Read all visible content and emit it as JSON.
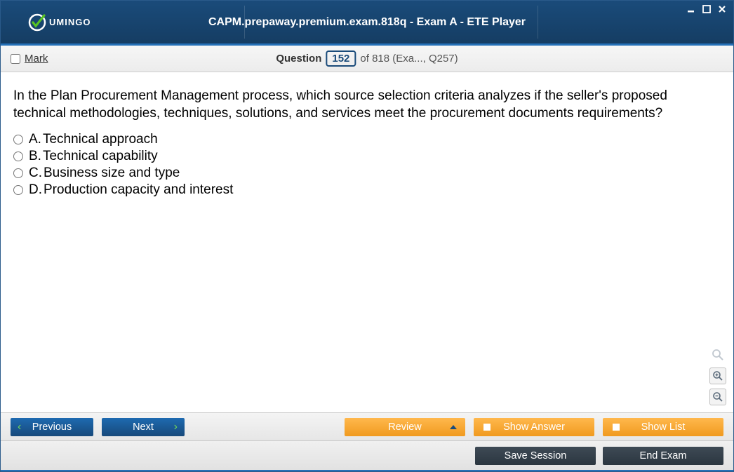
{
  "logo_text": "UMINGO",
  "title": "CAPM.prepaway.premium.exam.818q - Exam A - ETE Player",
  "mark_label": "Mark",
  "question_label": "Question",
  "question_number": "152",
  "question_total": "of 818 (Exa..., Q257)",
  "question_text": "In the Plan Procurement Management process, which source selection criteria analyzes if the seller's proposed technical methodologies, techniques, solutions, and services meet the procurement documents requirements?",
  "options": [
    {
      "letter": "A.",
      "text": "Technical approach"
    },
    {
      "letter": "B.",
      "text": "Technical capability"
    },
    {
      "letter": "C.",
      "text": "Business size and type"
    },
    {
      "letter": "D.",
      "text": "Production capacity and interest"
    }
  ],
  "buttons": {
    "previous": "Previous",
    "next": "Next",
    "review": "Review",
    "show_answer": "Show Answer",
    "show_list": "Show List",
    "save_session": "Save Session",
    "end_exam": "End Exam"
  }
}
